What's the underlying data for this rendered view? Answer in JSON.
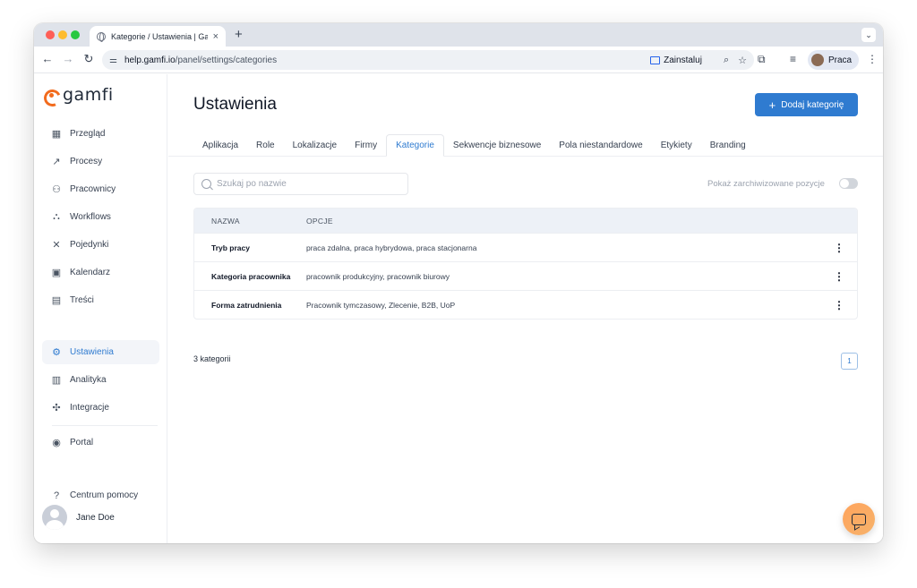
{
  "browser": {
    "tab_title": "Kategorie / Ustawienia | Gamfi",
    "tab_close": "×",
    "new_tab": "+",
    "tabs_menu": "⌄",
    "url_host": "help.gamfi.io",
    "url_path": "/panel/settings/categories",
    "install_label": "Zainstaluj",
    "profile_label": "Praca",
    "back": "←",
    "forward": "→",
    "reload": "↻",
    "zoom_icon": "⌕",
    "star_icon": "☆",
    "extensions_icon": "⧉",
    "media_icon": "≡",
    "menu_icon": "⋮"
  },
  "sidebar": {
    "logo_text": "gamfi",
    "items": [
      {
        "label": "Przegląd",
        "icon": "▦"
      },
      {
        "label": "Procesy",
        "icon": "↗"
      },
      {
        "label": "Pracownicy",
        "icon": "⚇"
      },
      {
        "label": "Workflows",
        "icon": "⛬"
      },
      {
        "label": "Pojedynki",
        "icon": "✕"
      },
      {
        "label": "Kalendarz",
        "icon": "▣"
      },
      {
        "label": "Treści",
        "icon": "▤"
      },
      {
        "label": "Ustawienia",
        "icon": "⚙"
      },
      {
        "label": "Analityka",
        "icon": "▥"
      },
      {
        "label": "Integracje",
        "icon": "✣"
      },
      {
        "label": "Portal",
        "icon": "◉"
      }
    ],
    "help": {
      "label": "Centrum pomocy",
      "icon": "?"
    },
    "user_name": "Jane Doe"
  },
  "main": {
    "title": "Ustawienia",
    "add_button": "Dodaj kategorię",
    "add_icon": "+",
    "tabs": [
      "Aplikacja",
      "Role",
      "Lokalizacje",
      "Firmy",
      "Kategorie",
      "Sekwencje biznesowe",
      "Pola niestandardowe",
      "Etykiety",
      "Branding"
    ],
    "active_tab": "Kategorie",
    "search_placeholder": "Szukaj po nazwie",
    "archived_label": "Pokaż zarchiwizowane pozycje",
    "table": {
      "headers": [
        "NAZWA",
        "OPCJE"
      ],
      "rows": [
        {
          "name": "Tryb pracy",
          "options": "praca zdalna, praca hybrydowa, praca stacjonarna"
        },
        {
          "name": "Kategoria pracownika",
          "options": "pracownik produkcyjny, pracownik biurowy"
        },
        {
          "name": "Forma zatrudnienia",
          "options": "Pracownik tymczasowy, Zlecenie, B2B, UoP"
        }
      ],
      "row_menu_icon": "⋮"
    },
    "count_label": "3 kategorii",
    "page_number": "1"
  },
  "colors": {
    "accent": "#2f7bd0",
    "brand_orange": "#f26b1d",
    "fab": "#ffa45c"
  }
}
